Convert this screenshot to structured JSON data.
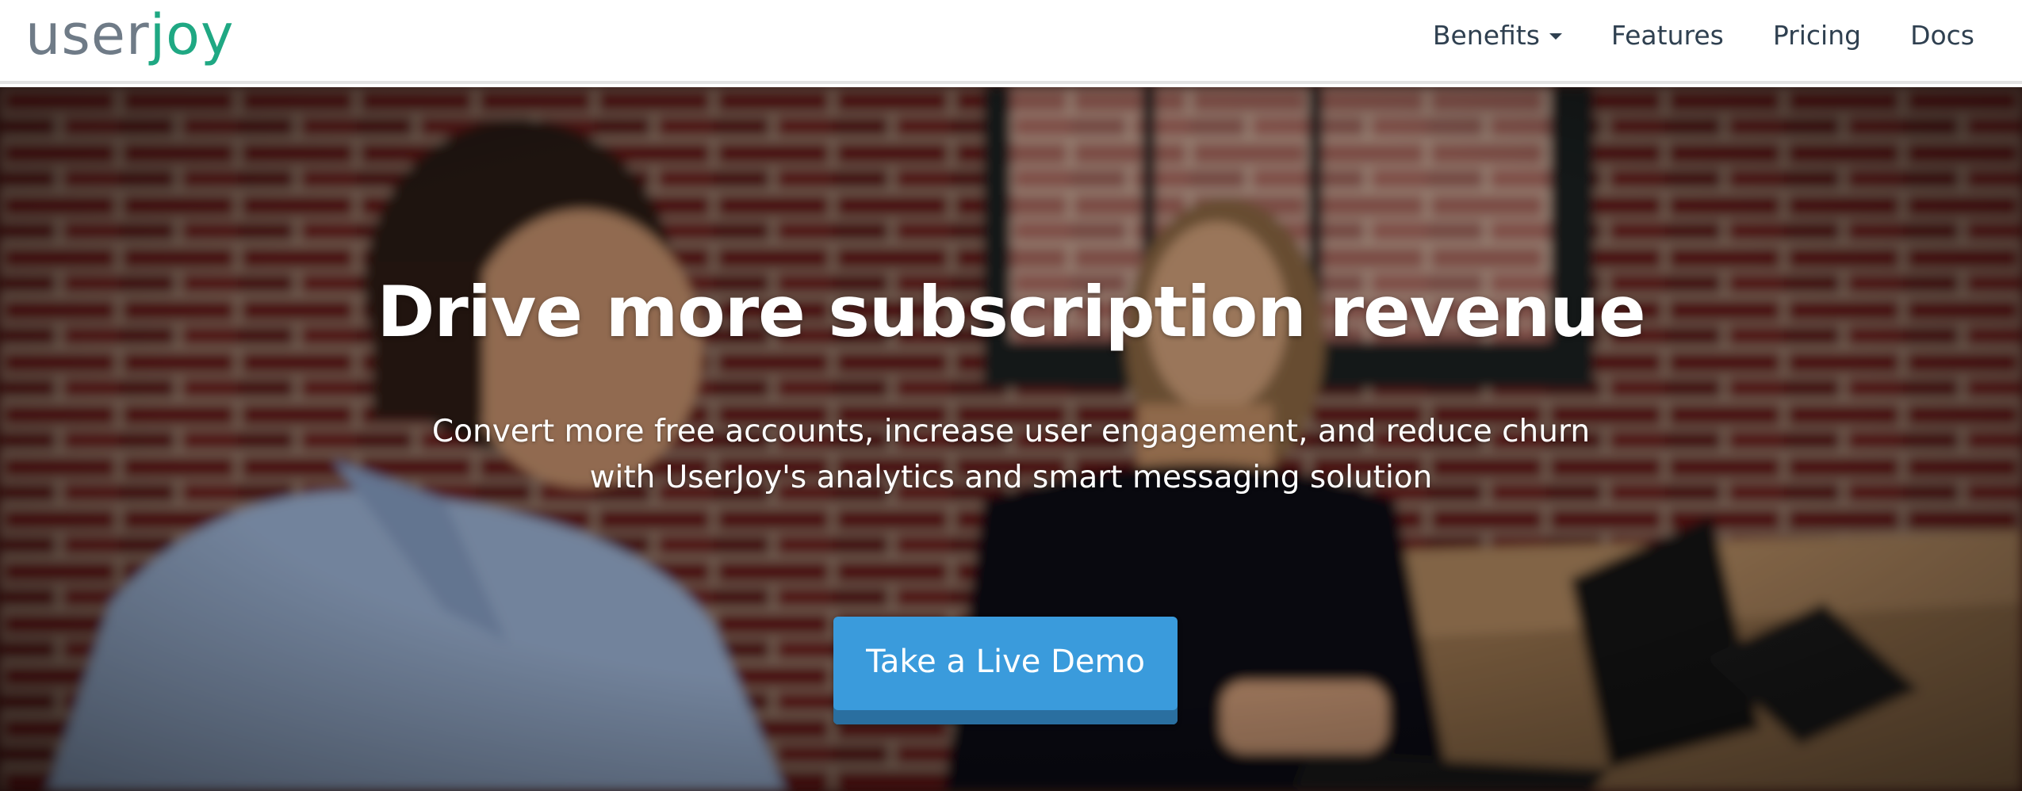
{
  "brand": {
    "logo_part1": "user",
    "logo_part2": "joy"
  },
  "nav": {
    "items": [
      {
        "label": "Benefits",
        "has_dropdown": true
      },
      {
        "label": "Features"
      },
      {
        "label": "Pricing"
      },
      {
        "label": "Docs"
      }
    ]
  },
  "hero": {
    "title": "Drive more subscription revenue",
    "subtitle_line1": "Convert more free accounts, increase user engagement, and reduce churn",
    "subtitle_line2": "with UserJoy's analytics and smart messaging solution",
    "cta_label": "Take a Live Demo"
  },
  "colors": {
    "logo_gray": "#6f7b87",
    "logo_green": "#1fa883",
    "nav_text": "#2f4050",
    "cta_blue": "#3a9bdc",
    "cta_shadow": "#2a6fa0"
  }
}
